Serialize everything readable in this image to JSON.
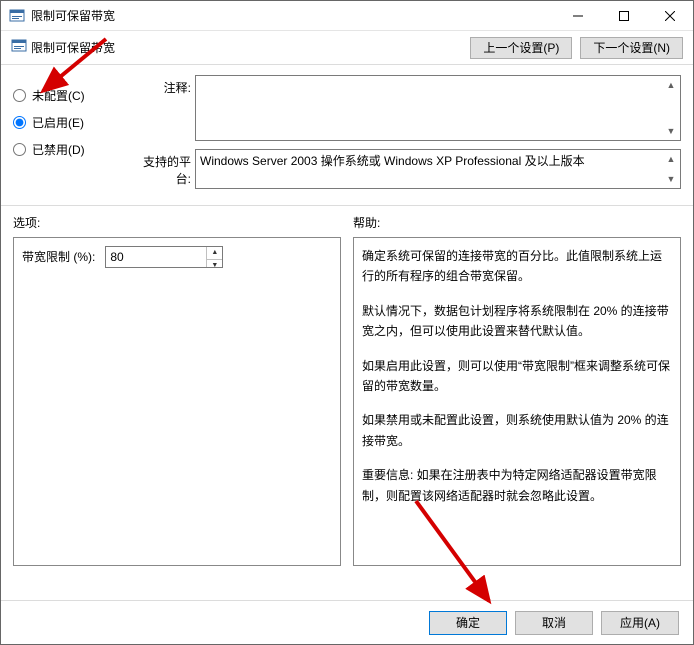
{
  "window": {
    "title": "限制可保留带宽"
  },
  "subheader": {
    "title": "限制可保留带宽",
    "prev": "上一个设置(P)",
    "next": "下一个设置(N)"
  },
  "radios": {
    "not_configured": "未配置(C)",
    "enabled": "已启用(E)",
    "disabled": "已禁用(D)",
    "selected": "enabled"
  },
  "fields": {
    "comment_label": "注释:",
    "comment_value": "",
    "platform_label": "支持的平台:",
    "platform_value": "Windows Server 2003 操作系统或 Windows XP Professional 及以上版本"
  },
  "options": {
    "section_label": "选项:",
    "bw_label": "带宽限制 (%):",
    "bw_value": "80"
  },
  "help": {
    "section_label": "帮助:",
    "p1": "确定系统可保留的连接带宽的百分比。此值限制系统上运行的所有程序的组合带宽保留。",
    "p2": "默认情况下，数据包计划程序将系统限制在 20% 的连接带宽之内，但可以使用此设置来替代默认值。",
    "p3": "如果启用此设置，则可以使用“带宽限制”框来调整系统可保留的带宽数量。",
    "p4": "如果禁用或未配置此设置，则系统使用默认值为 20% 的连接带宽。",
    "p5": "重要信息: 如果在注册表中为特定网络适配器设置带宽限制，则配置该网络适配器时就会忽略此设置。"
  },
  "buttons": {
    "ok": "确定",
    "cancel": "取消",
    "apply": "应用(A)"
  }
}
